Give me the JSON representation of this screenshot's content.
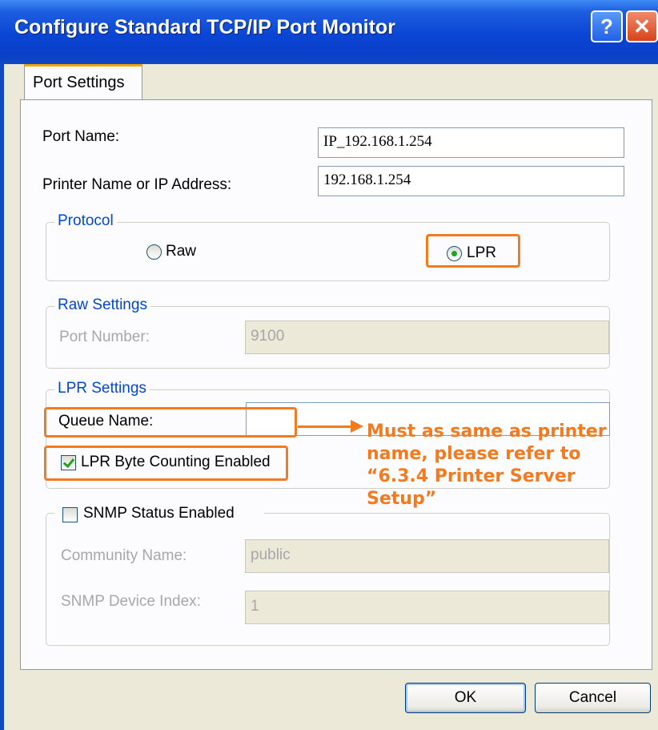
{
  "window": {
    "title": "Configure Standard TCP/IP Port Monitor",
    "help_glyph": "?",
    "close_glyph": "✕"
  },
  "tab": {
    "label": "Port Settings"
  },
  "port_name": {
    "label": "Port Name:",
    "value": "IP_192.168.1.254"
  },
  "printer_address": {
    "label": "Printer Name or IP Address:",
    "value": "192.168.1.254"
  },
  "protocol": {
    "title": "Protocol",
    "options": [
      {
        "label": "Raw",
        "selected": false
      },
      {
        "label": "LPR",
        "selected": true
      }
    ]
  },
  "raw_settings": {
    "title": "Raw Settings",
    "port_number_label": "Port Number:",
    "port_number_value": "9100"
  },
  "lpr_settings": {
    "title": "LPR Settings",
    "queue_name_label": "Queue Name:",
    "queue_name_value": "",
    "byte_counting_label": "LPR Byte Counting Enabled",
    "byte_counting_checked": true
  },
  "snmp": {
    "label": "SNMP Status Enabled",
    "checked": false,
    "community_label": "Community Name:",
    "community_value": "public",
    "device_index_label": "SNMP Device Index:",
    "device_index_value": "1"
  },
  "annotation": {
    "text_lines": [
      "Must as same as printer",
      "name, please refer to",
      "“6.3.4 Printer Server",
      "Setup”"
    ],
    "color": "#f47a20"
  },
  "buttons": {
    "ok": "OK",
    "cancel": "Cancel"
  },
  "colors": {
    "titlebar": "#0a45d4",
    "group_title": "#0046d5",
    "highlight": "#f47a20"
  }
}
